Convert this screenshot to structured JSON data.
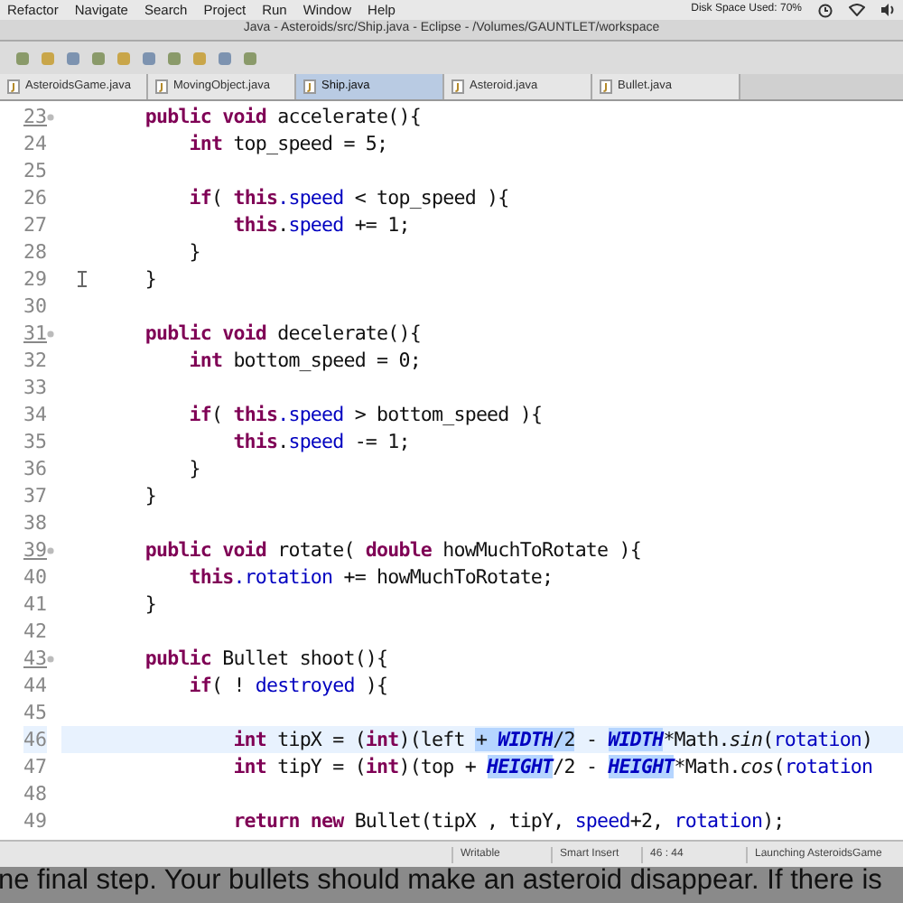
{
  "menu_bar": {
    "items": [
      "Refactor",
      "Navigate",
      "Search",
      "Project",
      "Run",
      "Window",
      "Help"
    ],
    "disk_space": "Disk Space Used: 70%"
  },
  "window": {
    "title": "Java - Asteroids/src/Ship.java - Eclipse - /Volumes/GAUNTLET/workspace"
  },
  "tabs": [
    {
      "label": "AsteroidsGame.java",
      "selected": false
    },
    {
      "label": "MovingObject.java",
      "selected": false
    },
    {
      "label": "Ship.java",
      "selected": true
    },
    {
      "label": "Asteroid.java",
      "selected": false
    },
    {
      "label": "Bullet.java",
      "selected": false
    }
  ],
  "editor": {
    "lines": [
      {
        "number": "23",
        "fold": true,
        "current": false,
        "tokens": [
          {
            "text": "    public void",
            "kind": "keyword"
          },
          {
            "text": " accelerate(){",
            "kind": "plain"
          }
        ]
      },
      {
        "number": "24",
        "fold": false,
        "current": false,
        "tokens": [
          {
            "text": "        int",
            "kind": "keyword"
          },
          {
            "text": " top_speed = 5;",
            "kind": "plain"
          }
        ]
      },
      {
        "number": "25",
        "fold": false,
        "current": false
      },
      {
        "number": "26",
        "fold": false,
        "current": false,
        "tokens": [
          {
            "text": "        if",
            "kind": "keyword"
          },
          {
            "text": "( ",
            "kind": "plain"
          },
          {
            "text": "this",
            "kind": "keyword"
          },
          {
            "text": ".speed",
            "kind": "field"
          },
          {
            "text": " < top_speed ){",
            "kind": "plain"
          }
        ]
      },
      {
        "number": "27",
        "fold": false,
        "current": false,
        "tokens": [
          {
            "text": "            this",
            "kind": "keyword"
          },
          {
            "text": ".",
            "kind": "plain"
          },
          {
            "text": "speed",
            "kind": "field"
          },
          {
            "text": " += 1;",
            "kind": "plain"
          }
        ]
      },
      {
        "number": "28",
        "fold": false,
        "current": false,
        "tokens": [
          {
            "text": "        }",
            "kind": "plain"
          }
        ]
      },
      {
        "number": "29",
        "fold": false,
        "current": false,
        "cursor": true,
        "tokens": [
          {
            "text": "    }",
            "kind": "plain"
          }
        ]
      },
      {
        "number": "30",
        "fold": false,
        "current": false
      },
      {
        "number": "31",
        "fold": true,
        "current": false,
        "tokens": [
          {
            "text": "    public void",
            "kind": "keyword"
          },
          {
            "text": " decelerate(){",
            "kind": "plain"
          }
        ]
      },
      {
        "number": "32",
        "fold": false,
        "current": false,
        "tokens": [
          {
            "text": "        int",
            "kind": "keyword"
          },
          {
            "text": " bottom_speed = 0;",
            "kind": "plain"
          }
        ]
      },
      {
        "number": "33",
        "fold": false,
        "current": false
      },
      {
        "number": "34",
        "fold": false,
        "current": false,
        "tokens": [
          {
            "text": "        if",
            "kind": "keyword"
          },
          {
            "text": "( ",
            "kind": "plain"
          },
          {
            "text": "this",
            "kind": "keyword"
          },
          {
            "text": ".speed",
            "kind": "field"
          },
          {
            "text": " > bottom_speed ){",
            "kind": "plain"
          }
        ]
      },
      {
        "number": "35",
        "fold": false,
        "current": false,
        "tokens": [
          {
            "text": "            this",
            "kind": "keyword"
          },
          {
            "text": ".",
            "kind": "plain"
          },
          {
            "text": "speed",
            "kind": "field"
          },
          {
            "text": " -= 1;",
            "kind": "plain"
          }
        ]
      },
      {
        "number": "36",
        "fold": false,
        "current": false,
        "tokens": [
          {
            "text": "        }",
            "kind": "plain"
          }
        ]
      },
      {
        "number": "37",
        "fold": false,
        "current": false,
        "tokens": [
          {
            "text": "    }",
            "kind": "plain"
          }
        ]
      },
      {
        "number": "38",
        "fold": false,
        "current": false
      },
      {
        "number": "39",
        "fold": true,
        "current": false,
        "tokens": [
          {
            "text": "    public void",
            "kind": "keyword"
          },
          {
            "text": " rotate( ",
            "kind": "plain"
          },
          {
            "text": "double",
            "kind": "keyword"
          },
          {
            "text": " howMuchToRotate ){",
            "kind": "plain"
          }
        ]
      },
      {
        "number": "40",
        "fold": false,
        "current": false,
        "tokens": [
          {
            "text": "        this",
            "kind": "keyword"
          },
          {
            "text": ".rotation",
            "kind": "field"
          },
          {
            "text": " += howMuchToRotate;",
            "kind": "plain"
          }
        ]
      },
      {
        "number": "41",
        "fold": false,
        "current": false,
        "tokens": [
          {
            "text": "    }",
            "kind": "plain"
          }
        ]
      },
      {
        "number": "42",
        "fold": false,
        "current": false
      },
      {
        "number": "43",
        "fold": true,
        "current": false,
        "tokens": [
          {
            "text": "    public",
            "kind": "keyword"
          },
          {
            "text": " Bullet shoot(){",
            "kind": "plain"
          }
        ]
      },
      {
        "number": "44",
        "fold": false,
        "current": false,
        "tokens": [
          {
            "text": "        if",
            "kind": "keyword"
          },
          {
            "text": "( ! ",
            "kind": "plain"
          },
          {
            "text": "destroyed",
            "kind": "field"
          },
          {
            "text": " ){",
            "kind": "plain"
          }
        ]
      },
      {
        "number": "45",
        "fold": false,
        "current": false
      },
      {
        "number": "46",
        "fold": false,
        "current": true,
        "tokens": [
          {
            "text": "            int",
            "kind": "keyword"
          },
          {
            "text": " tipX = (",
            "kind": "plain"
          },
          {
            "text": "int",
            "kind": "keyword"
          },
          {
            "text": ")(left ",
            "kind": "plain"
          },
          {
            "text": "+ ",
            "kind": "selected"
          },
          {
            "text": "WIDTH",
            "kind": "constant"
          },
          {
            "text": "/2",
            "kind": "selected"
          },
          {
            "text": " - ",
            "kind": "plain"
          },
          {
            "text": "WIDTH",
            "kind": "constant"
          },
          {
            "text": "*Math.",
            "kind": "plain"
          },
          {
            "text": "sin",
            "kind": "static"
          },
          {
            "text": "(",
            "kind": "plain"
          },
          {
            "text": "rotation",
            "kind": "field"
          },
          {
            "text": ")",
            "kind": "plain"
          }
        ]
      },
      {
        "number": "47",
        "fold": false,
        "current": false,
        "tokens": [
          {
            "text": "            int",
            "kind": "keyword"
          },
          {
            "text": " tipY = (",
            "kind": "plain"
          },
          {
            "text": "int",
            "kind": "keyword"
          },
          {
            "text": ")(top + ",
            "kind": "plain"
          },
          {
            "text": "HEIGHT",
            "kind": "constant"
          },
          {
            "text": "/2 - ",
            "kind": "plain"
          },
          {
            "text": "HEIGHT",
            "kind": "constant"
          },
          {
            "text": "*Math.",
            "kind": "plain"
          },
          {
            "text": "cos",
            "kind": "static"
          },
          {
            "text": "(",
            "kind": "plain"
          },
          {
            "text": "rotation",
            "kind": "field"
          }
        ]
      },
      {
        "number": "48",
        "fold": false,
        "current": false
      },
      {
        "number": "49",
        "fold": false,
        "current": false,
        "tokens": [
          {
            "text": "            return new",
            "kind": "keyword"
          },
          {
            "text": " Bullet(tipX , tipY, ",
            "kind": "plain"
          },
          {
            "text": "speed",
            "kind": "field"
          },
          {
            "text": "+2, ",
            "kind": "plain"
          },
          {
            "text": "rotation",
            "kind": "field"
          },
          {
            "text": ");",
            "kind": "plain"
          }
        ]
      }
    ]
  },
  "status_bar": {
    "items": [
      "Writable",
      "Smart Insert",
      "46 : 44",
      "Launching AsteroidsGame"
    ]
  },
  "caption": "ne final step. Your bullets should make an asteroid disappear. If there is"
}
